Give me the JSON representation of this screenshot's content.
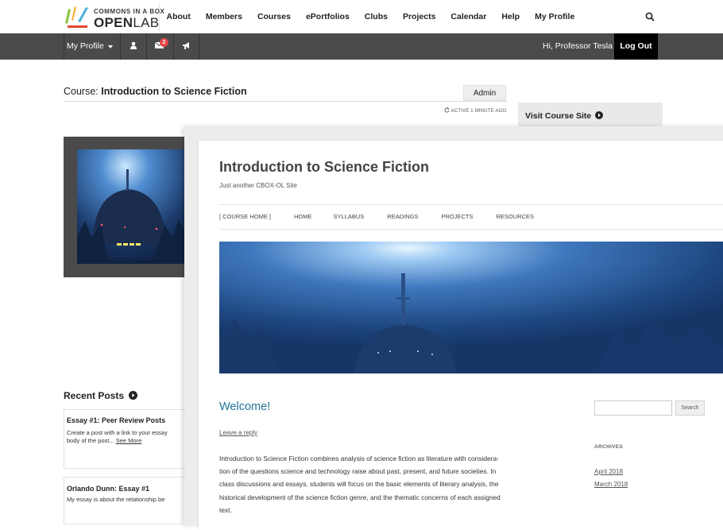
{
  "topnav": {
    "logo_line1": "COMMONS IN A BOX",
    "logo_open": "OPEN",
    "logo_lab": "LAB",
    "links": [
      "About",
      "Members",
      "Courses",
      "ePortfolios",
      "Clubs",
      "Projects",
      "Calendar",
      "Help",
      "My Profile"
    ],
    "search_icon": "search-icon"
  },
  "adminbar": {
    "my_profile": "My Profile",
    "message_count": "2",
    "greeting": "Hi, Professor Tesla",
    "logout": "Log Out",
    "icons": [
      "user-icon",
      "envelope-icon",
      "megaphone-icon"
    ]
  },
  "course": {
    "prefix": "Course: ",
    "name": "Introduction to Science Fiction",
    "admin_tab": "Admin",
    "active": "ACTIVE 1 MINUTE AGO",
    "visit": "Visit Course Site"
  },
  "recent": {
    "title": "Recent Posts",
    "posts": [
      {
        "title": "Essay #1: Peer Review Posts",
        "excerpt_line1": "Create a post with a link to your essay",
        "excerpt_line2": "body of the post...",
        "more": "See More"
      },
      {
        "title": "Orlando Dunn: Essay #1",
        "excerpt_line1": "My essay is about the relationship be"
      }
    ]
  },
  "site": {
    "title": "Introduction to Science Fiction",
    "tagline": "Just another CBOX-OL Site",
    "menu": [
      "[ COURSE HOME ]",
      "HOME",
      "SYLLABUS",
      "READINGS",
      "PROJECTS",
      "RESOURCES"
    ],
    "post_title": "Welcome!",
    "reply": "Leave a reply",
    "entry_lines": [
      "Introduction to Science Fiction combines analysis of science fiction as literature with considera-",
      "tion of the questions science and technology raise about past, present, and future societies. In",
      "class discussions and essays, students will focus on the basic elements of literary analysis, the",
      "historical development of the science fiction genre, and the thematic concerns of each assigned",
      "text."
    ],
    "search_button": "Search",
    "archives_title": "ARCHIVES",
    "archives": [
      "April 2018",
      "March 2018"
    ]
  },
  "colors": {
    "accent_link": "#21759b",
    "adminbar_bg": "#4a4a4a",
    "badge": "#e64543"
  }
}
